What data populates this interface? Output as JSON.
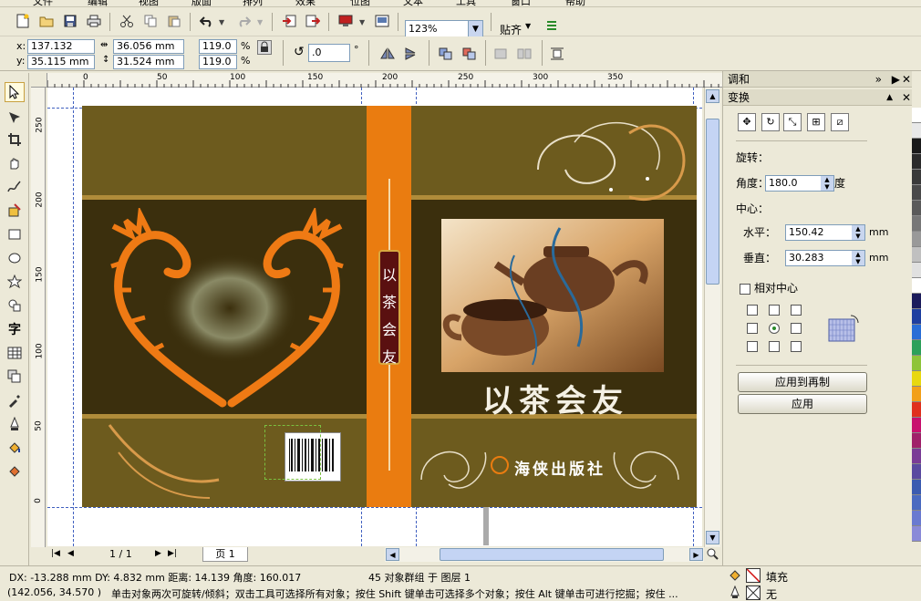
{
  "menubar": {
    "items": [
      "文件",
      "编辑",
      "视图",
      "版面",
      "排列",
      "效果",
      "位图",
      "文本",
      "工具",
      "窗口",
      "帮助"
    ]
  },
  "toolbar": {
    "zoom": "123%",
    "snap": "贴齐",
    "icons": [
      "new-icon",
      "open-icon",
      "save-icon",
      "print-icon",
      "cut-icon",
      "copy-icon",
      "paste-icon",
      "undo-icon",
      "redo-icon",
      "import-icon",
      "export-icon",
      "publish-icon",
      "app-launcher-icon",
      "options-icon"
    ]
  },
  "property_bar": {
    "x_label": "x:",
    "y_label": "y:",
    "x": "137.132 mm",
    "y": "35.115 mm",
    "w": "36.056 mm",
    "h": "31.524 mm",
    "scale_x": "119.0",
    "scale_y": "119.0",
    "pct": "%",
    "angle": ".0",
    "deg": "°"
  },
  "rulers": {
    "h_ticks": [
      "0",
      "50",
      "100",
      "150",
      "200",
      "250",
      "300",
      "350"
    ],
    "v_ticks": [
      "250",
      "200",
      "150",
      "100",
      "50",
      "0"
    ],
    "unit": "毫米"
  },
  "cover": {
    "title": "以茶会友",
    "spine_text": [
      "以",
      "茶",
      "会",
      "友"
    ],
    "publisher": "海侠出版社",
    "colors": {
      "background": "#6d5b1e",
      "spine": "#ea7c10",
      "dragon": "#ef7a14",
      "band": "#b08c3a"
    }
  },
  "docker": {
    "panel1": "调和",
    "panel2": "变换",
    "rotate_label": "旋转：",
    "angle_label": "角度：",
    "angle": "180.0",
    "degree_unit": "度",
    "center_label": "中心：",
    "horizontal_label": "水平：",
    "horizontal": "150.42",
    "vertical_label": "垂直：",
    "vertical": "30.283",
    "mm": "mm",
    "relative_center": "相对中心",
    "apply_copy": "应用到再制",
    "apply": "应用"
  },
  "page_nav": {
    "counter": "1 / 1",
    "tab": "页 1"
  },
  "status": {
    "metrics": "DX: -13.288 mm DY: 4.832 mm 距离: 14.139 角度: 160.017",
    "selection": "45 对象群组 于 图层 1",
    "coords": "(142.056, 34.570 )",
    "hint": "单击对象两次可旋转/倾斜；双击工具可选择所有对象；按住 Shift 键单击可选择多个对象；按住 Alt 键单击可进行挖掘；按住 ...",
    "fill": "填充",
    "outline": "无"
  },
  "palette": [
    "#ffffff",
    "#e8e8e8",
    "#1a1a1a",
    "#2b2b2b",
    "#3a3a3a",
    "#4a4a4a",
    "#5a5a5a",
    "#777777",
    "#999999",
    "#c0c0c0",
    "#e0e0e0",
    "#ffffff",
    "#1c1c5c",
    "#1e3fa0",
    "#2a6ed6",
    "#2ca05a",
    "#8ec43a",
    "#e8d810",
    "#f2a01a",
    "#e0301e",
    "#c8106e",
    "#a0206a",
    "#7a3c96",
    "#5a4aa0",
    "#3b5bb0",
    "#4a6ac0",
    "#6a7ad0",
    "#8a8ad8"
  ]
}
